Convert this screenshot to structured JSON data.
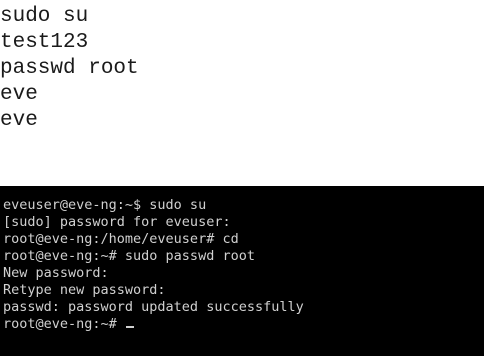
{
  "snippet": {
    "lines": [
      "sudo su",
      "test123",
      "passwd root",
      "eve",
      "eve"
    ]
  },
  "terminal": {
    "lines": [
      "eveuser@eve-ng:~$ sudo su",
      "[sudo] password for eveuser:",
      "root@eve-ng:/home/eveuser# cd",
      "root@eve-ng:~# sudo passwd root",
      "New password:",
      "Retype new password:",
      "passwd: password updated successfully",
      "root@eve-ng:~# "
    ],
    "colors": {
      "background": "#000000",
      "foreground": "#d0d0d0"
    }
  }
}
